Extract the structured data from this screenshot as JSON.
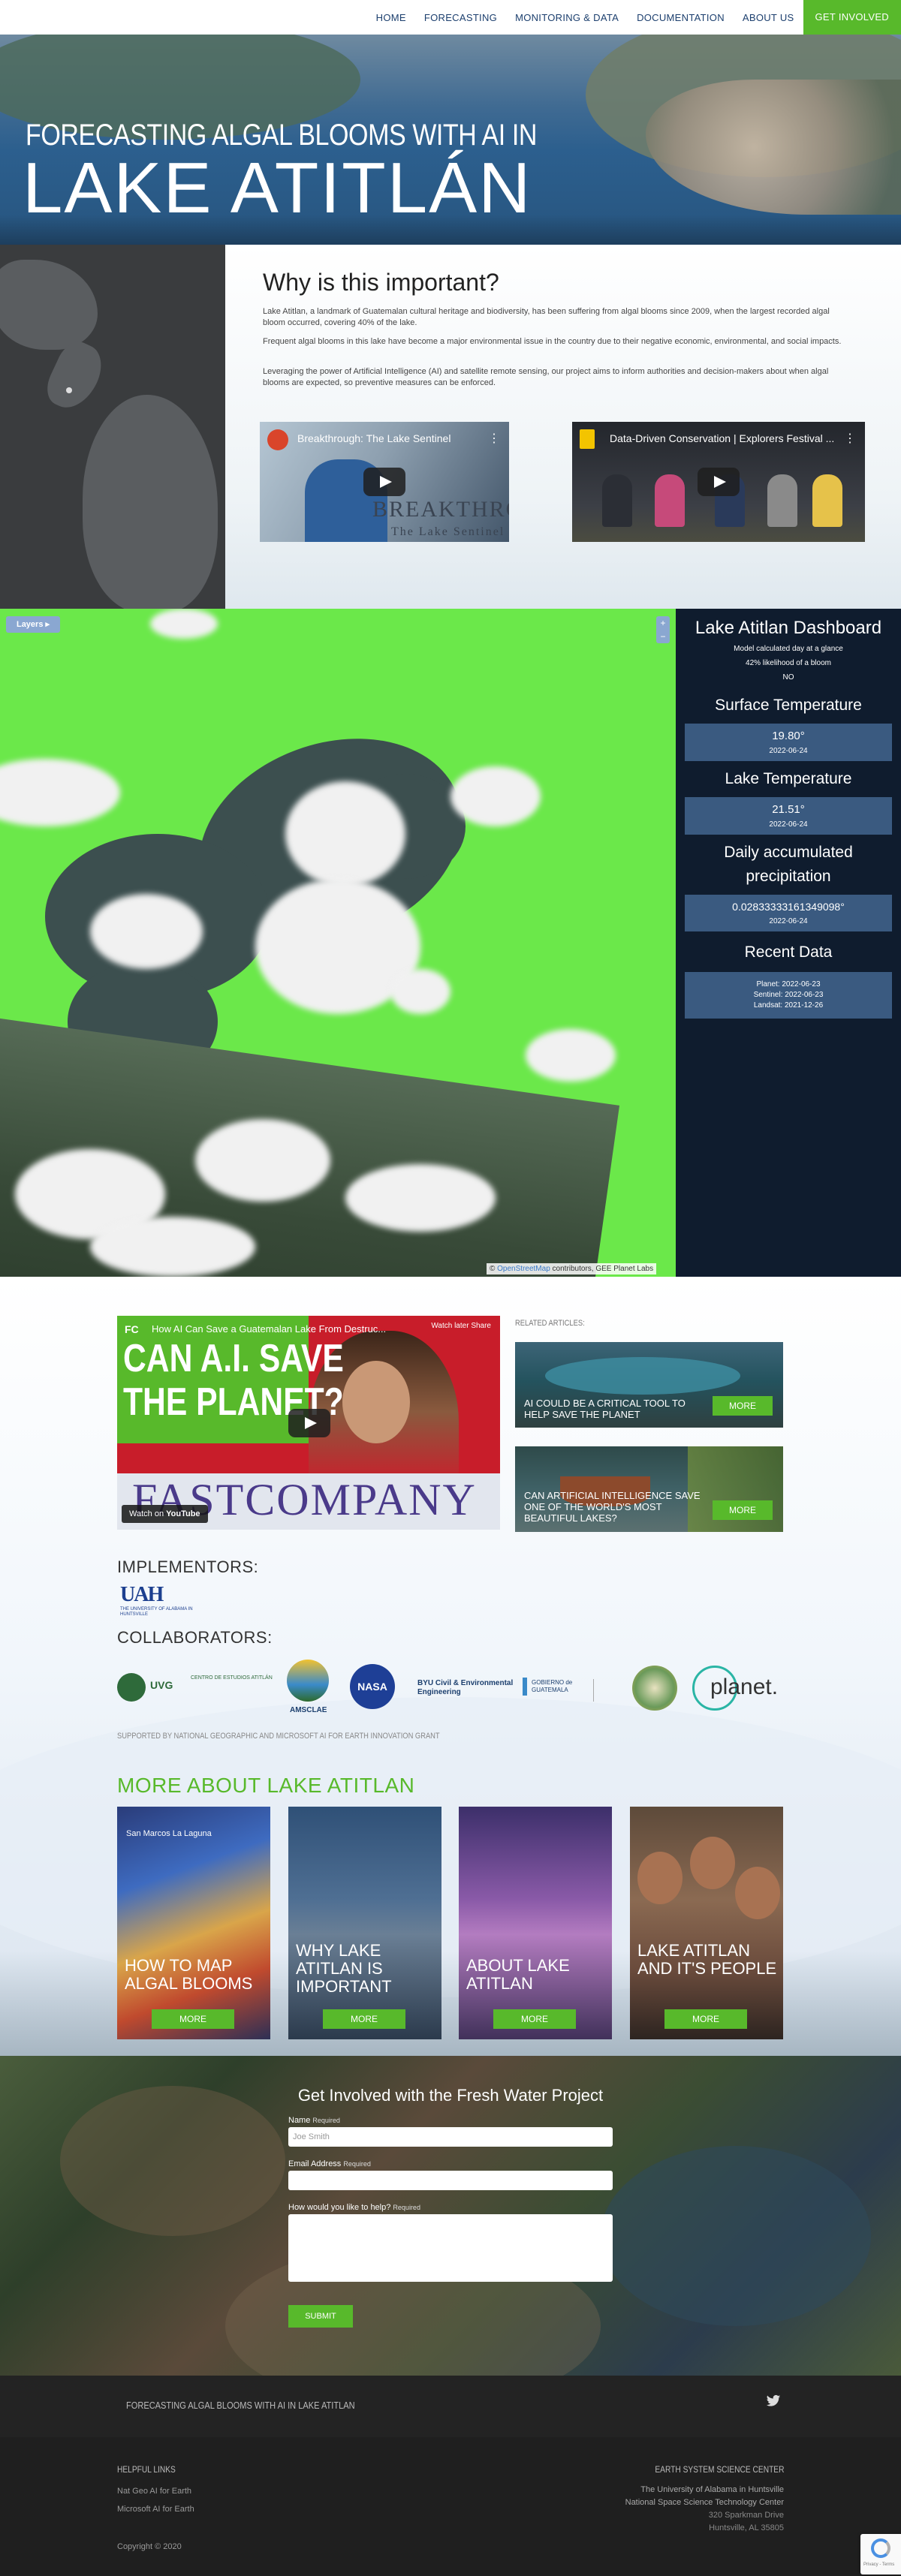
{
  "nav": {
    "items": [
      "HOME",
      "FORECASTING",
      "MONITORING & DATA",
      "DOCUMENTATION",
      "ABOUT US"
    ],
    "cta": "GET INVOLVED"
  },
  "hero": {
    "subtitle": "FORECASTING ALGAL BLOOMS WITH AI IN",
    "title": "LAKE ATITLÁN"
  },
  "why": {
    "heading": "Why is this important?",
    "paragraphs": [
      "Lake Atitlan, a landmark of Guatemalan cultural heritage and biodiversity, has been suffering from algal blooms since 2009, when the largest recorded algal bloom occurred, covering 40% of the lake.",
      "Frequent algal blooms in this lake have become a major environmental issue in the country due to their negative economic, environmental, and social impacts.",
      "Leveraging the power of Artificial Intelligence (AI) and satellite remote sensing, our project aims to inform authorities and decision-makers about when algal blooms are expected, so preventive measures can be enforced."
    ],
    "videos": [
      {
        "title": "Breakthrough: The Lake Sentinel",
        "overlay_big": "BREAKTHROUGH",
        "overlay_small": "The Lake Sentinel"
      },
      {
        "title": "Data-Driven Conservation | Explorers Festival ..."
      }
    ]
  },
  "dashboard": {
    "layers_label": "Layers",
    "zoom_in": "+",
    "zoom_out": "−",
    "attribution_prefix": "©",
    "attribution_link": "OpenStreetMap",
    "attribution_rest": "contributors, GEE Planet Labs",
    "title": "Lake Atitlan Dashboard",
    "model_note": "Model calculated day at a glance",
    "likelihood": "42% likelihood of a bloom",
    "bloom_answer": "NO",
    "surface_temp": {
      "label": "Surface Temperature",
      "value": "19.80°",
      "date": "2022-06-24"
    },
    "lake_temp": {
      "label": "Lake Temperature",
      "value": "21.51°",
      "date": "2022-06-24"
    },
    "precip": {
      "label": "Daily accumulated precipitation",
      "value": "0.02833333161349098°",
      "date": "2022-06-24"
    },
    "recent": {
      "label": "Recent Data",
      "planet": "Planet: 2022-06-23",
      "sentinel": "Sentinel: 2022-06-23",
      "landsat": "Landsat: 2021-12-26"
    }
  },
  "media": {
    "fc_video": {
      "logo": "FC",
      "title": "How AI Can Save a Guatemalan Lake From Destruc...",
      "headline_line1": "CAN A.I. SAVE",
      "headline_line2": "THE PLANET?",
      "brand": "FASTCOMPANY",
      "watch_on": "Watch on",
      "youtube": "YouTube",
      "watch_later": "Watch later",
      "share": "Share"
    },
    "related_label": "RELATED ARTICLES:",
    "related": [
      {
        "title": "AI COULD BE A CRITICAL TOOL TO HELP SAVE THE PLANET",
        "button": "MORE"
      },
      {
        "title": "CAN ARTIFICIAL INTELLIGENCE SAVE ONE OF THE WORLD'S MOST BEAUTIFUL LAKES?",
        "button": "MORE"
      }
    ]
  },
  "implementors": {
    "heading": "IMPLEMENTORS:",
    "uah_mark": "UAH",
    "uah_text": "THE UNIVERSITY OF ALABAMA IN HUNTSVILLE"
  },
  "collaborators": {
    "heading": "COLLABORATORS:",
    "uvg": "UVG",
    "uvg_sub": "CENTRO DE ESTUDIOS ATITLÁN",
    "amsclae": "AMSCLAE",
    "nasa": "NASA",
    "byu": "BYU Civil & Environmental Engineering",
    "gobierno": "GOBIERNO de GUATEMALA",
    "planet": "planet."
  },
  "supported": "SUPPORTED BY NATIONAL GEOGRAPHIC AND MICROSOFT AI FOR EARTH INNOVATION GRANT",
  "more_about": {
    "heading": "MORE ABOUT LAKE ATITLAN",
    "map_labels": "San Marcos La Laguna",
    "cards": [
      {
        "title": "HOW TO MAP ALGAL BLOOMS",
        "button": "MORE"
      },
      {
        "title": "WHY LAKE ATITLAN IS IMPORTANT",
        "button": "MORE"
      },
      {
        "title": "ABOUT LAKE ATITLAN",
        "button": "MORE"
      },
      {
        "title": "LAKE ATITLAN AND IT'S PEOPLE",
        "button": "MORE"
      }
    ]
  },
  "involved": {
    "heading": "Get Involved with the Fresh Water Project",
    "name_label": "Name",
    "name_req": "Required",
    "name_placeholder": "Joe Smith",
    "email_label": "Email Address",
    "email_req": "Required",
    "help_label": "How would you like to help?",
    "help_req": "Required",
    "submit": "SUBMIT"
  },
  "footer": {
    "title": "FORECASTING ALGAL BLOOMS WITH AI IN LAKE ATITLAN",
    "helpful_heading": "HELPFUL LINKS",
    "links": [
      "Nat Geo AI for Earth",
      "Microsoft AI for Earth"
    ],
    "copyright": "Copyright © 2020",
    "center_heading": "EARTH SYSTEM SCIENCE CENTER",
    "address_line1": "The University of Alabama in Huntsville",
    "address_line2": "National Space Science Technology Center",
    "address_line3": "320 Sparkman Drive",
    "address_line4": "Huntsville, AL 35805"
  },
  "recaptcha": {
    "text": "Privacy - Terms"
  },
  "colors": {
    "accent_green": "#58b92b",
    "nav_blue": "#1c3f6e",
    "dashboard_panel": "#0f1c2e",
    "dashboard_box": "#3a5a80"
  }
}
